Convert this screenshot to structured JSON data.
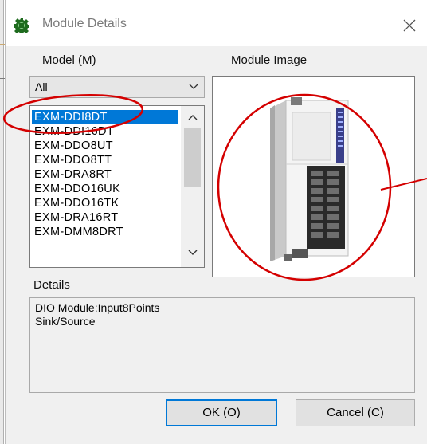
{
  "window": {
    "title": "Module Details",
    "icon": "module-gear-icon",
    "close_icon": "close-x-icon"
  },
  "model": {
    "label": "Model (M)",
    "filter_value": "All",
    "items": [
      "EXM-DDI8DT",
      "EXM-DDI16DT",
      "EXM-DDO8UT",
      "EXM-DDO8TT",
      "EXM-DRA8RT",
      "EXM-DDO16UK",
      "EXM-DDO16TK",
      "EXM-DRA16RT",
      "EXM-DMM8DRT"
    ],
    "selected_index": 0
  },
  "module_image": {
    "label": "Module Image",
    "image": "plc-expansion-module"
  },
  "details": {
    "label": "Details",
    "lines": [
      "DIO Module:Input8Points",
      "Sink/Source"
    ]
  },
  "buttons": {
    "ok": "OK (O)",
    "cancel": "Cancel (C)"
  },
  "colors": {
    "selection": "#0078d7",
    "annotation": "#d40000",
    "dialog_bg": "#f0f0f0"
  }
}
